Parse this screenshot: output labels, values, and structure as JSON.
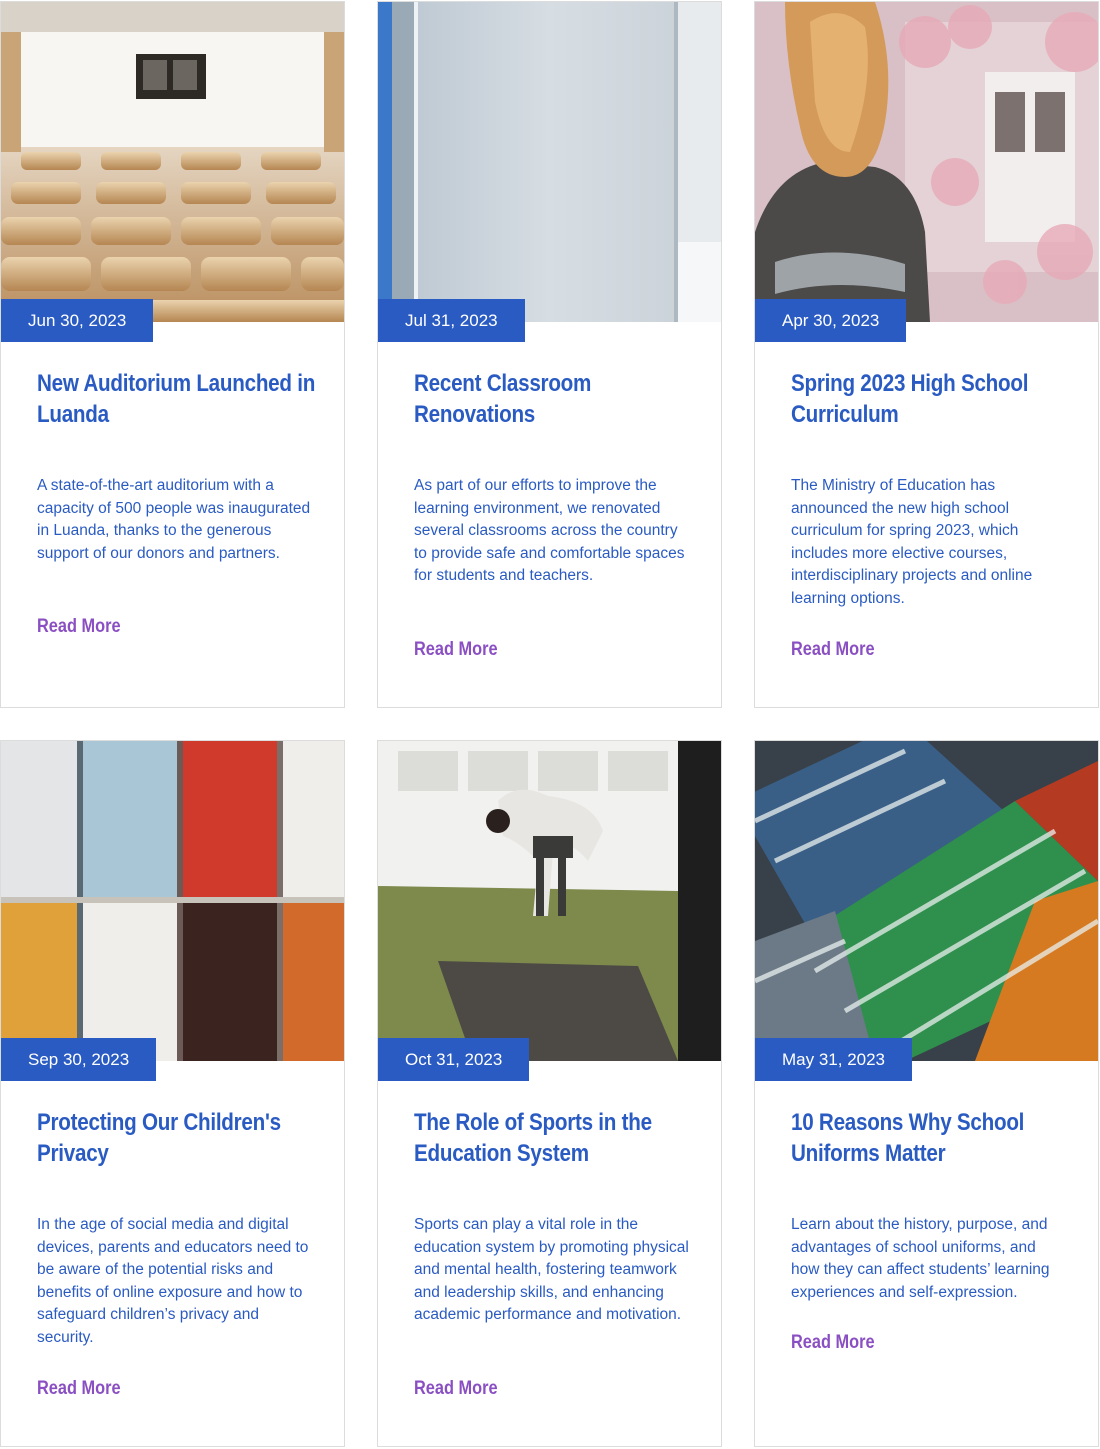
{
  "posts": [
    {
      "date": "Jun 30, 2023",
      "title": "New Auditorium Launched in Luanda",
      "description": "A state-of-the-art auditorium with a capacity of 500 people was inaugurated in Luanda, thanks to the generous support of our donors and partners.",
      "link_label": "Read More",
      "image": "auditorium-image"
    },
    {
      "date": "Jul 31, 2023",
      "title": "Recent Classroom Renovations",
      "description": "As part of our efforts to improve the learning environment, we renovated several classrooms across the country to provide safe and comfortable spaces for students and teachers.",
      "link_label": "Read More",
      "image": "classroom-wall-image"
    },
    {
      "date": "Apr 30, 2023",
      "title": "Spring 2023 High School Curriculum",
      "description": "The Ministry of Education has announced the new high school curriculum for spring 2023, which includes more elective courses, interdisciplinary projects and online learning options.",
      "link_label": "Read More",
      "image": "student-blossom-image"
    },
    {
      "date": "Sep 30, 2023",
      "title": "Protecting Our Children's Privacy",
      "description": "In the age of social media and digital devices, parents and educators need to be aware of the potential risks and benefits of online exposure and how to safeguard children’s privacy and security.",
      "link_label": "Read More",
      "image": "lockers-image"
    },
    {
      "date": "Oct 31, 2023",
      "title": "The Role of Sports in the Education System",
      "description": "Sports can play a vital role in the education system by promoting physical and mental health, fostering teamwork and leadership skills, and enhancing academic performance and motivation.",
      "link_label": "Read More",
      "image": "gym-stretch-image"
    },
    {
      "date": "May 31, 2023",
      "title": "10 Reasons Why School Uniforms Matter",
      "description": "Learn about the history, purpose, and advantages of school uniforms, and how they can affect students’ learning experiences and self-expression.",
      "link_label": "Read More",
      "image": "striped-ties-image"
    }
  ],
  "colors": {
    "accent_blue": "#2a5bc2",
    "link_purple": "#8a4fc2",
    "border": "#dcdcdc"
  }
}
